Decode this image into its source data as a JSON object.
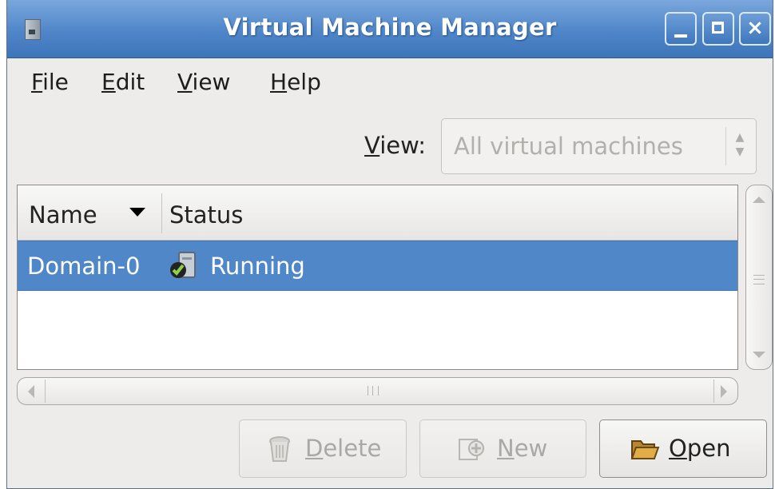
{
  "window": {
    "title": "Virtual Machine Manager",
    "controls": [
      "minimize",
      "maximize",
      "close"
    ]
  },
  "menubar": {
    "items": [
      {
        "label": "File",
        "mnemonic": "F",
        "rest": "ile"
      },
      {
        "label": "Edit",
        "mnemonic": "E",
        "rest": "dit"
      },
      {
        "label": "View",
        "mnemonic": "V",
        "rest": "iew"
      },
      {
        "label": "Help",
        "mnemonic": "H",
        "rest": "elp"
      }
    ]
  },
  "filter": {
    "label_mnemonic": "V",
    "label_rest": "iew:",
    "selected": "All virtual machines"
  },
  "table": {
    "columns": [
      "Name",
      "Status"
    ],
    "sort_icon": "sort-descending-icon",
    "rows": [
      {
        "name": "Domain-0",
        "status": "Running",
        "status_icon": "running-vm-icon",
        "selected": true
      }
    ]
  },
  "buttons": {
    "delete": {
      "mnemonic": "D",
      "rest": "elete",
      "enabled": false,
      "icon": "trash-icon"
    },
    "new": {
      "mnemonic": "N",
      "rest": "ew",
      "enabled": false,
      "icon": "new-vm-icon"
    },
    "open": {
      "mnemonic": "O",
      "rest": "pen",
      "enabled": true,
      "icon": "folder-icon"
    }
  },
  "colors": {
    "titlebar": "#4f86c9",
    "selection": "#4f87c8",
    "window_bg": "#edeceb"
  }
}
